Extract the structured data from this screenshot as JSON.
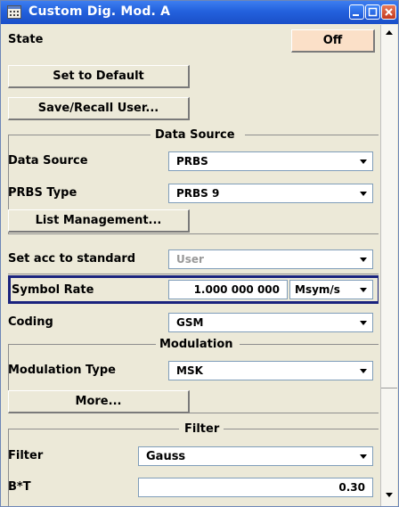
{
  "window": {
    "title": "Custom Dig. Mod. A"
  },
  "state": {
    "label": "State",
    "button": "Off"
  },
  "buttons": {
    "set_default": "Set to Default",
    "save_recall": "Save/Recall User..."
  },
  "data_source_group": {
    "title": "Data Source",
    "data_source": {
      "label": "Data Source",
      "value": "PRBS"
    },
    "prbs_type": {
      "label": "PRBS Type",
      "value": "PRBS 9"
    },
    "list_management": "List Management..."
  },
  "set_acc": {
    "label": "Set acc to standard",
    "value": "User"
  },
  "symbol_rate": {
    "label": "Symbol Rate",
    "value": "1.000 000 000",
    "unit": "Msym/s"
  },
  "coding": {
    "label": "Coding",
    "value": "GSM"
  },
  "modulation_group": {
    "title": "Modulation",
    "modulation_type": {
      "label": "Modulation Type",
      "value": "MSK"
    },
    "more": "More..."
  },
  "filter_group": {
    "title": "Filter",
    "filter": {
      "label": "Filter",
      "value": "Gauss"
    },
    "bt": {
      "label": "B*T",
      "value": "0.30"
    }
  }
}
